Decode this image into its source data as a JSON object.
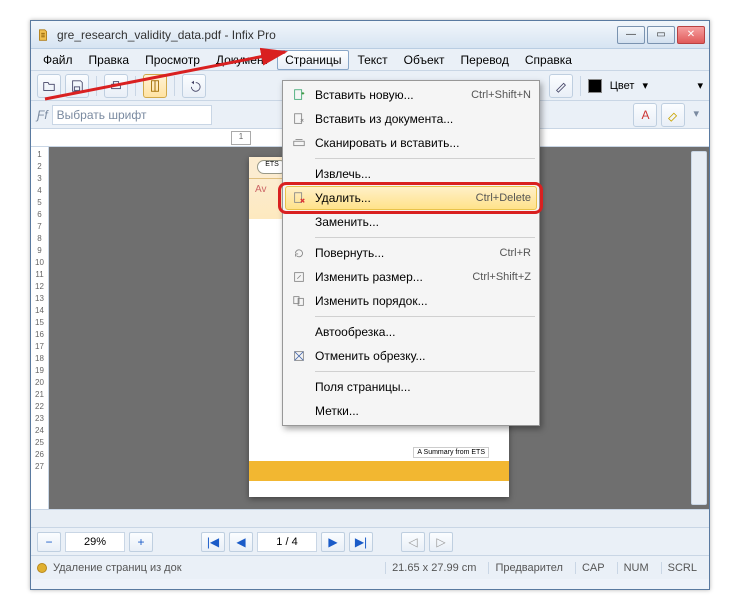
{
  "window": {
    "title": "gre_research_validity_data.pdf - Infix Pro",
    "controls": {
      "min": "—",
      "max": "▭",
      "close": "✕"
    }
  },
  "menubar": [
    "Файл",
    "Правка",
    "Просмотр",
    "Документ",
    "Страницы",
    "Текст",
    "Объект",
    "Перевод",
    "Справка"
  ],
  "menubar_open_index": 4,
  "toolbar": {
    "font_placeholder": "Выбрать шрифт",
    "color_label": "Цвет",
    "color_swatch": "#000000"
  },
  "ruler": {
    "tab_label": "1",
    "v_ticks": [
      "1",
      "2",
      "3",
      "4",
      "5",
      "6",
      "7",
      "8",
      "9",
      "10",
      "11",
      "12",
      "13",
      "14",
      "15",
      "16",
      "17",
      "18",
      "19",
      "20",
      "21",
      "22",
      "23",
      "24",
      "25",
      "26",
      "27"
    ]
  },
  "page": {
    "logo": "ETS",
    "summary": "A Summary from ETS",
    "midword": "Av"
  },
  "dropdown": {
    "items": [
      {
        "icon": "page-plus-icon",
        "label": "Вставить новую...",
        "shortcut": "Ctrl+Shift+N"
      },
      {
        "icon": "page-doc-icon",
        "label": "Вставить из документа..."
      },
      {
        "icon": "scanner-icon",
        "label": "Сканировать и вставить..."
      },
      {
        "divider": true
      },
      {
        "icon": "",
        "label": "Извлечь..."
      },
      {
        "icon": "page-delete-icon",
        "label": "Удалить...",
        "shortcut": "Ctrl+Delete",
        "highlight": true
      },
      {
        "icon": "",
        "label": "Заменить..."
      },
      {
        "divider": true
      },
      {
        "icon": "rotate-icon",
        "label": "Повернуть...",
        "shortcut": "Ctrl+R"
      },
      {
        "icon": "resize-icon",
        "label": "Изменить размер...",
        "shortcut": "Ctrl+Shift+Z"
      },
      {
        "icon": "reorder-icon",
        "label": "Изменить порядок..."
      },
      {
        "divider": true
      },
      {
        "icon": "",
        "label": "Автообрезка..."
      },
      {
        "icon": "crop-cancel-icon",
        "label": "Отменить обрезку..."
      },
      {
        "divider": true
      },
      {
        "icon": "",
        "label": "Поля страницы..."
      },
      {
        "icon": "",
        "label": "Метки..."
      }
    ]
  },
  "nav": {
    "zoom": "29%",
    "page": "1 / 4"
  },
  "status": {
    "message": "Удаление страниц из док",
    "dims": "21.65 x 27.99 cm",
    "preview": "Предварител",
    "cap": "CAP",
    "num": "NUM",
    "scrl": "SCRL"
  }
}
